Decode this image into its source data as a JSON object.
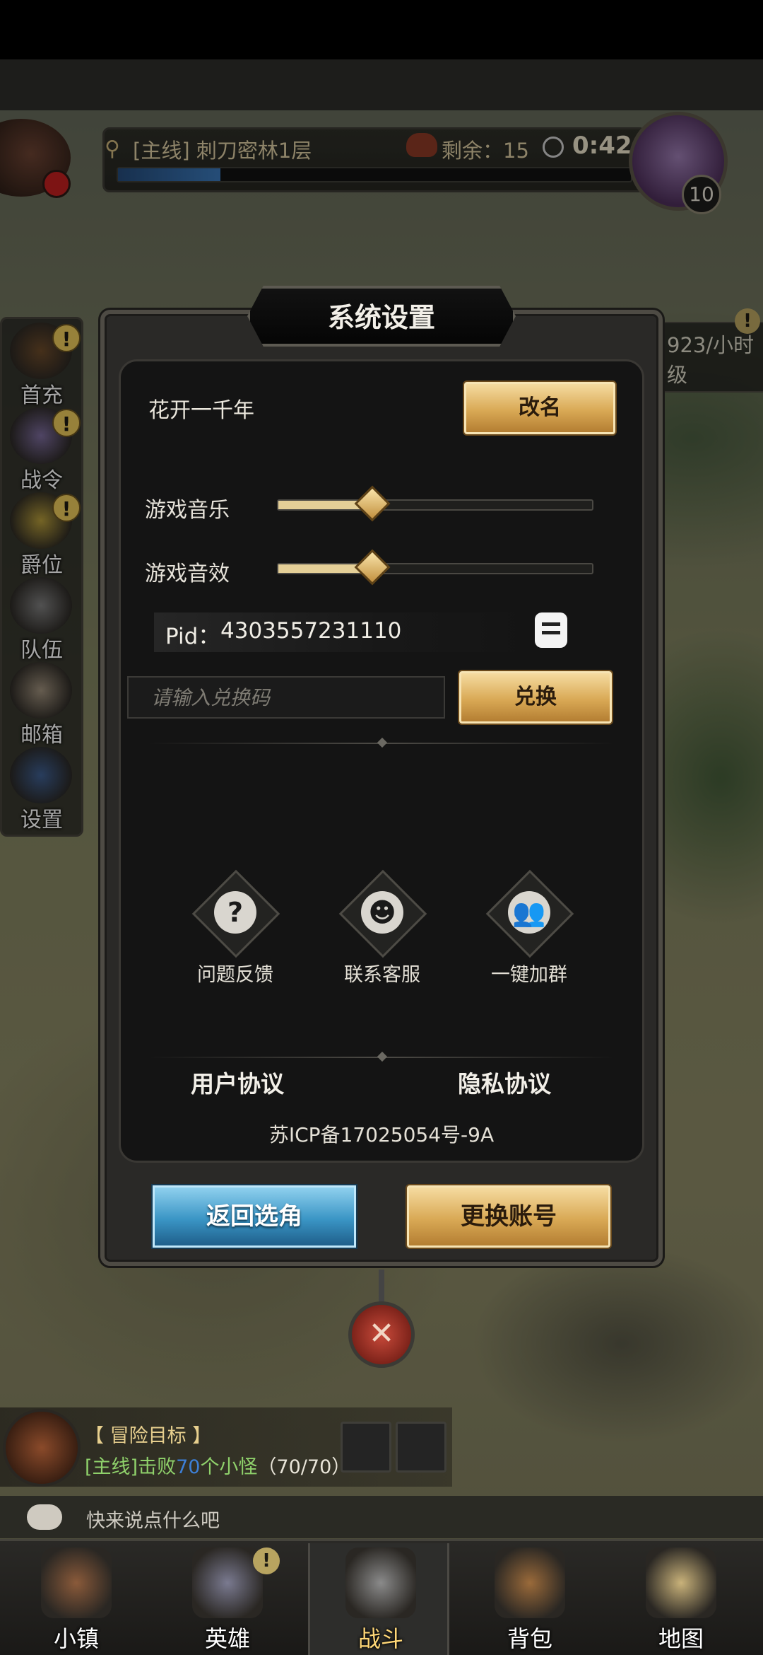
{
  "hud": {
    "stage": "[主线] 刺刀密林1层",
    "remaining": "剩余：15",
    "timer": "0:42",
    "boss_level": "10",
    "stage_progress": 0.2
  },
  "side_menu": [
    {
      "label": "首充",
      "icon": "treasure-chest-icon",
      "alert": "!"
    },
    {
      "label": "战令",
      "icon": "winged-badge-icon",
      "alert": "!"
    },
    {
      "label": "爵位",
      "icon": "crown-icon",
      "alert": "!"
    },
    {
      "label": "队伍",
      "icon": "team-faces-icon"
    },
    {
      "label": "邮箱",
      "icon": "mail-letter-icon"
    },
    {
      "label": "设置",
      "icon": "gear-icon"
    }
  ],
  "right_rate": {
    "text": "923/小时级",
    "alert": "!"
  },
  "dialog": {
    "title": "系统设置",
    "username": "花开一千年",
    "rename_label": "改名",
    "music_label": "游戏音乐",
    "music_level": 0.3,
    "sfx_label": "游戏音效",
    "sfx_level": 0.3,
    "pid_label": "Pid：",
    "pid_value": "4303557231110",
    "code_placeholder": "请输入兑换码",
    "redeem_label": "兑换",
    "actions": [
      {
        "label": "问题反馈",
        "icon": "question-icon",
        "glyph": "?"
      },
      {
        "label": "联系客服",
        "icon": "headset-support-icon",
        "glyph": "☻"
      },
      {
        "label": "一键加群",
        "icon": "group-icon",
        "glyph": "👥"
      }
    ],
    "user_agreement": "用户协议",
    "privacy_agreement": "隐私协议",
    "icp": "苏ICP备17025054号-9A",
    "back_label": "返回选角",
    "switch_label": "更换账号",
    "close_glyph": "✕"
  },
  "quest": {
    "title": "【 冒险目标 】",
    "desc_prefix": "[主线]击败",
    "desc_count": "70",
    "desc_suffix": "个小怪",
    "progress": "（70/70）"
  },
  "chat": {
    "placeholder": "快来说点什么吧"
  },
  "bottom_nav": [
    {
      "label": "小镇",
      "icon": "town-icon"
    },
    {
      "label": "英雄",
      "icon": "hero-elf-icon",
      "alert": "!"
    },
    {
      "label": "战斗",
      "icon": "crossed-swords-icon",
      "active": true
    },
    {
      "label": "背包",
      "icon": "backpack-icon"
    },
    {
      "label": "地图",
      "icon": "map-scroll-icon"
    }
  ],
  "colors": {
    "gold_button": "#d9a955",
    "blue_button": "#3a95c5",
    "slider_fill": "#e4cf97",
    "quest_green": "#8fd16b",
    "quest_blue": "#3d7fd6"
  }
}
